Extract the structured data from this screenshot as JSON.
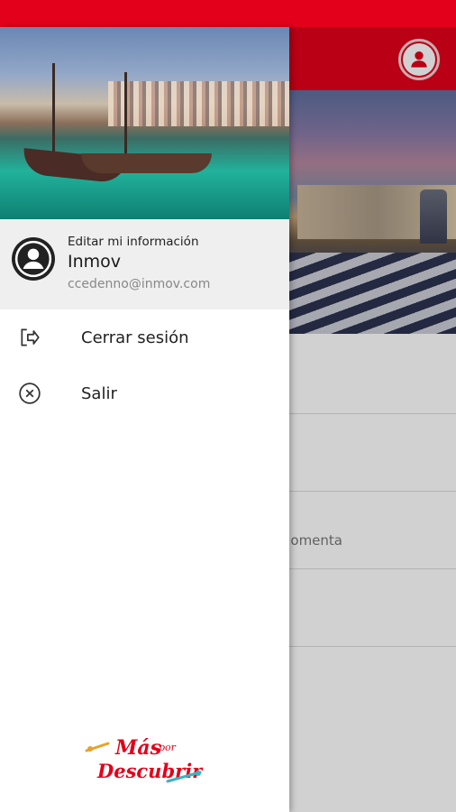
{
  "colors": {
    "brand_red": "#e2001a",
    "panel_gray": "#efefef"
  },
  "header": {
    "profile_icon": "user-circle-icon"
  },
  "background_list": {
    "partial_text": "omenta"
  },
  "drawer": {
    "image_alt": "drawer-header-photo",
    "user": {
      "edit_label": "Editar mi información",
      "name": "Inmov",
      "email": "ccedenno@inmov.com",
      "avatar_icon": "user-avatar-icon"
    },
    "menu": [
      {
        "label": "Cerrar sesión",
        "icon": "logout-icon"
      },
      {
        "label": "Salir",
        "icon": "close-circle-icon"
      }
    ],
    "logo": {
      "line1": "Más",
      "line2": "por",
      "line3": "Descubrir"
    }
  }
}
